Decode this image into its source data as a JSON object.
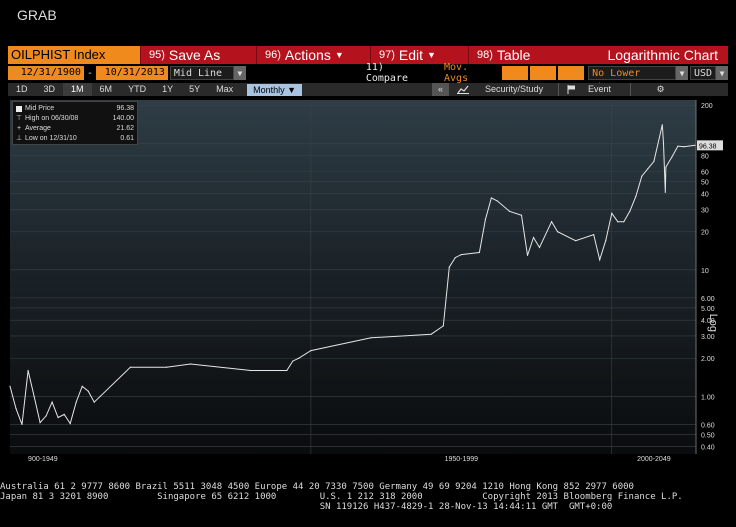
{
  "window": {
    "title": "GRAB"
  },
  "toolbar": {
    "ticker": "OILPHIST Index",
    "buttons": [
      {
        "num": "95)",
        "label": "Save As",
        "caret": false
      },
      {
        "num": "96)",
        "label": "Actions",
        "caret": true
      },
      {
        "num": "97)",
        "label": "Edit",
        "caret": true
      },
      {
        "num": "98)",
        "label": "Table",
        "caret": false
      }
    ],
    "chart_type": "Logarithmic Chart"
  },
  "range_bar": {
    "start_date": "12/31/1900",
    "separator": "-",
    "end_date": "10/31/2013",
    "line_mode": "Mid Line",
    "compare": "11) Compare",
    "mov_avgs": "Mov. Avgs",
    "lower_chart": "No Lower Chart",
    "currency": "USD"
  },
  "period_bar": {
    "periods": [
      "1D",
      "3D",
      "1M",
      "6M",
      "YTD",
      "1Y",
      "5Y",
      "Max"
    ],
    "active_period": "1M",
    "frequency": "Monthly",
    "back_icon": "«",
    "tools": [
      {
        "icon": "chart-study-icon",
        "label": "Security/Study"
      },
      {
        "icon": "flag-event-icon",
        "label": "Event"
      },
      {
        "icon": "gear-icon",
        "label": ""
      }
    ]
  },
  "legend": {
    "items": [
      {
        "label": "Mid Price",
        "value": "96.38"
      },
      {
        "label": "High on 06/30/08",
        "value": "140.00"
      },
      {
        "label": "Average",
        "value": "21.62"
      },
      {
        "label": "Low on 12/31/10",
        "value": "0.61"
      }
    ]
  },
  "chart_data": {
    "type": "line",
    "scale": "log",
    "ylabel": "Log",
    "ylim": [
      0.35,
      220
    ],
    "y_ticks": [
      200,
      100,
      80,
      60,
      50,
      40,
      30,
      20,
      10,
      6.0,
      5.0,
      4.0,
      3.0,
      2.0,
      1.0,
      0.6,
      0.5,
      0.4
    ],
    "y_tick_labels": [
      "200",
      "100",
      "80",
      "60",
      "50",
      "40",
      "30",
      "20",
      "10",
      "6.00",
      "5.00",
      "4.00",
      "3.00",
      "2.00",
      "1.00",
      "0.60",
      "0.50",
      "0.40"
    ],
    "x_range": [
      1900,
      2014
    ],
    "x_band_labels": [
      {
        "label": "900-1949",
        "x": 1903
      },
      {
        "label": "1950-1999",
        "x": 1975
      },
      {
        "label": "2000-2049",
        "x": 2007
      }
    ],
    "last_value_label": "96.38",
    "grid": true,
    "legend_position": "top-left",
    "line_color": "#e6e6e6",
    "series": [
      {
        "name": "Mid Price",
        "x": [
          1900,
          1901,
          1902,
          1903,
          1904,
          1905,
          1906,
          1907,
          1908,
          1909,
          1910,
          1911,
          1912,
          1913,
          1914,
          1915,
          1920,
          1926,
          1930,
          1940,
          1946,
          1947,
          1948,
          1950,
          1960,
          1970,
          1972,
          1973,
          1974,
          1975,
          1978,
          1979,
          1980,
          1981,
          1983,
          1985,
          1986,
          1987,
          1988,
          1990,
          1991,
          1994,
          1997,
          1998,
          1999,
          2000,
          2001,
          2002,
          2003,
          2004,
          2005,
          2006,
          2007,
          2008.4,
          2008.6,
          2008.9,
          2009,
          2010,
          2011,
          2012,
          2013.8
        ],
        "y": [
          1.2,
          0.8,
          0.6,
          1.6,
          1.0,
          0.62,
          0.7,
          0.9,
          0.68,
          0.72,
          0.61,
          0.9,
          1.2,
          1.1,
          0.9,
          1.0,
          1.7,
          1.7,
          1.8,
          1.6,
          1.6,
          1.9,
          2.0,
          2.3,
          2.9,
          3.1,
          3.6,
          10.5,
          12.5,
          13.2,
          13.7,
          25,
          37,
          35,
          29,
          27,
          13,
          18,
          15,
          24,
          20,
          17,
          19,
          12,
          17,
          28,
          24,
          24,
          29,
          38,
          55,
          63,
          72,
          140,
          100,
          41,
          65,
          78,
          95,
          94,
          96.38
        ]
      }
    ]
  },
  "footer": {
    "line1": "Australia 61 2 9777 8600 Brazil 5511 3048 4500 Europe 44 20 7330 7500 Germany 49 69 9204 1210 Hong Kong 852 2977 6000",
    "line2": "Japan 81 3 3201 8900         Singapore 65 6212 1000        U.S. 1 212 318 2000           Copyright 2013 Bloomberg Finance L.P.",
    "line3": "                                                           SN 119126 H437-4829-1 28-Nov-13 14:44:11 GMT  GMT+0:00"
  }
}
